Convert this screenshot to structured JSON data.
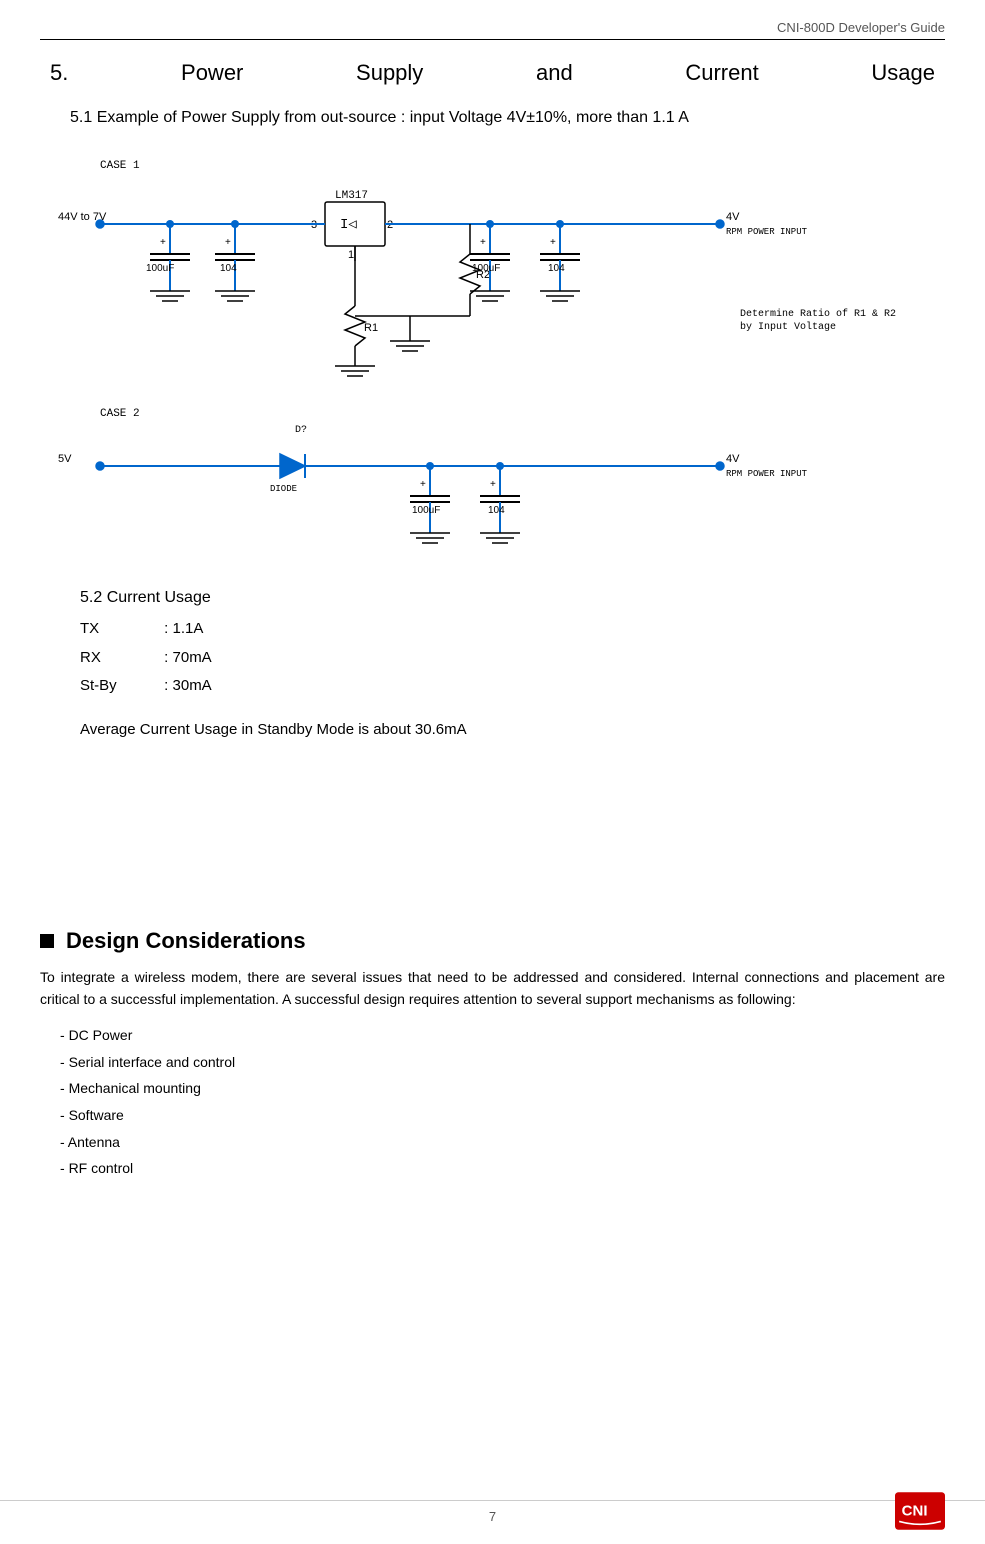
{
  "header": {
    "title": "CNI-800D Developer's Guide"
  },
  "section5": {
    "number": "5.",
    "title_parts": [
      "Power",
      "Supply",
      "and",
      "Current",
      "Usage"
    ],
    "subsection_51": {
      "title": "5.1 Example of Power Supply from out-source : input Voltage 4V±10%, more than 1.1 A"
    },
    "circuit_case1": {
      "label": "CASE 1",
      "voltage_in": "44V to 7V",
      "voltage_out": "4V",
      "ic": "LM317",
      "pins": [
        "1",
        "2",
        "3"
      ],
      "cap1": "100uF",
      "cap2": "104",
      "cap3": "100uF",
      "cap4": "104",
      "r1": "R1",
      "r2": "R2",
      "rpm_label": "RPM POWER INPUT",
      "note": "Determine Ratio of R1 & R2\nby Input Voltage"
    },
    "circuit_case2": {
      "label": "CASE 2",
      "voltage_in": "5V",
      "voltage_out": "4V",
      "diode_label": "DIODE",
      "diode_name": "D?",
      "cap1": "100uF",
      "cap2": "104",
      "rpm_label": "RPM POWER INPUT"
    },
    "subsection_52": {
      "title": "5.2  Current Usage",
      "tx": {
        "label": "TX",
        "value": ": 1.1A"
      },
      "rx": {
        "label": "RX",
        "value": ": 70mA"
      },
      "stby": {
        "label": "St-By",
        "value": ": 30mA"
      },
      "average": "Average Current Usage in Standby Mode is about 30.6mA"
    }
  },
  "design": {
    "heading": "Design Considerations",
    "body": "To integrate a wireless modem, there are several issues that need to be addressed and considered. Internal connections and placement are critical to a successful implementation. A successful design requires attention to several support mechanisms as following:",
    "list_items": [
      "DC Power",
      "Serial interface and control",
      "Mechanical mounting",
      "Software",
      "Antenna",
      "RF control"
    ]
  },
  "footer": {
    "page_number": "7"
  }
}
